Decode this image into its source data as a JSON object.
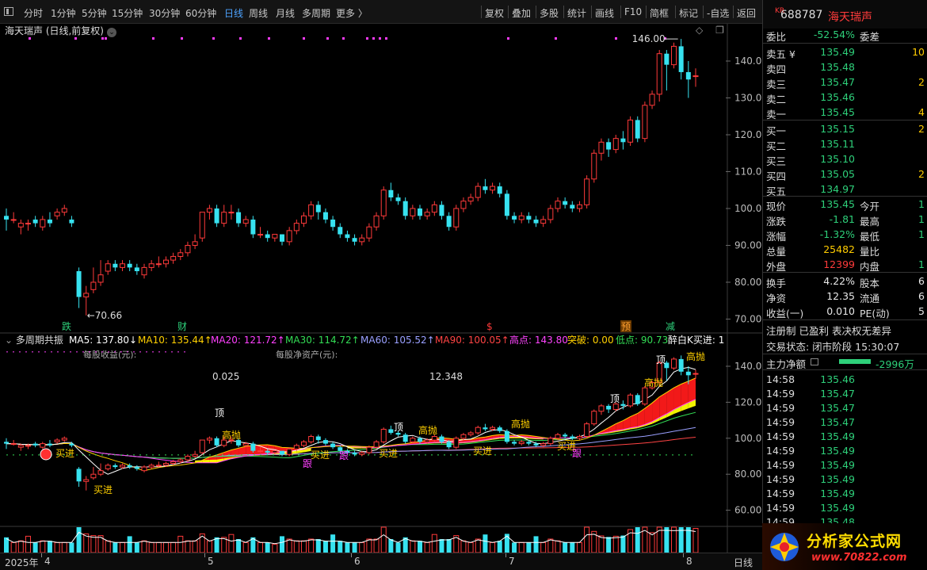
{
  "toolbar": {
    "periods": [
      "分时",
      "1分钟",
      "5分钟",
      "15分钟",
      "30分钟",
      "60分钟",
      "日线",
      "周线",
      "月线",
      "多周期",
      "更多 〉"
    ],
    "active_period": "日线",
    "actions": [
      "复权",
      "叠加",
      "多股",
      "统计",
      "画线",
      "F10",
      "简框",
      "标记",
      "-自选",
      "返回"
    ]
  },
  "chart": {
    "title": "海天瑞声 (日线,前复权)",
    "y_ticks_top": [
      "140.00",
      "130.00",
      "120.00",
      "110.00",
      "100.00",
      "90.00",
      "80.00",
      "70.00"
    ],
    "high_label": "146.00",
    "low_label": "←70.66",
    "event_markers": [
      "跌",
      "财",
      "$",
      "预",
      "减"
    ],
    "indicator_name": "多周期共振",
    "ma": [
      {
        "label": "MA5: 137.80↓",
        "color": "#ffffff"
      },
      {
        "label": "MA10: 135.44↑",
        "color": "#ffd000"
      },
      {
        "label": "MA20: 121.72↑",
        "color": "#ff40ff"
      },
      {
        "label": "MA30: 114.72↑",
        "color": "#33dd55"
      },
      {
        "label": "MA60: 105.52↑",
        "color": "#9aa0ff"
      },
      {
        "label": "MA90: 100.05↑",
        "color": "#ff4444"
      },
      {
        "label": "高点: 143.80",
        "color": "#ff44ff"
      },
      {
        "label": "突破: 0.00",
        "color": "#ffd000"
      },
      {
        "label": "低点: 90.73",
        "color": "#33dd55"
      },
      {
        "label": "醉白K买进: 1",
        "color": "#ffffff"
      }
    ],
    "eps_label": "每股收益(元):",
    "eps_value": "0.025",
    "nav_label": "每股净资产(元):",
    "nav_value": "12.348",
    "y_ticks_bottom": [
      "140.00",
      "120.00",
      "100.00",
      "80.00",
      "60.00"
    ],
    "signal_labels": [
      "买进",
      "买进",
      "买进",
      "买进",
      "买进",
      "买进",
      "高抛",
      "高抛",
      "高抛",
      "高抛",
      "高抛",
      "顶",
      "顶",
      "顶",
      "顶",
      "跟",
      "跟",
      "跟"
    ],
    "x_labels": [
      "2025年",
      "4",
      "5",
      "6",
      "7",
      "8"
    ],
    "bottom_right_label": "日线"
  },
  "quote": {
    "code": "688787",
    "name": "海天瑞声",
    "weibi_label": "委比",
    "weibi": "-52.54%",
    "weicha_label": "委差",
    "asks": [
      {
        "label": "卖五 ¥",
        "price": "135.49",
        "vol": "10"
      },
      {
        "label": "卖四",
        "price": "135.48",
        "vol": ""
      },
      {
        "label": "卖三",
        "price": "135.47",
        "vol": "2"
      },
      {
        "label": "卖二",
        "price": "135.46",
        "vol": ""
      },
      {
        "label": "卖一",
        "price": "135.45",
        "vol": "4"
      }
    ],
    "bids": [
      {
        "label": "买一",
        "price": "135.15",
        "vol": "2"
      },
      {
        "label": "买二",
        "price": "135.11",
        "vol": ""
      },
      {
        "label": "买三",
        "price": "135.10",
        "vol": ""
      },
      {
        "label": "买四",
        "price": "135.05",
        "vol": "2"
      },
      {
        "label": "买五",
        "price": "134.97",
        "vol": ""
      }
    ],
    "stats": [
      {
        "l1": "现价",
        "v1": "135.45",
        "c1": "green",
        "l2": "今开",
        "v2": "1"
      },
      {
        "l1": "涨跌",
        "v1": "-1.81",
        "c1": "green",
        "l2": "最高",
        "v2": "1"
      },
      {
        "l1": "涨幅",
        "v1": "-1.32%",
        "c1": "green",
        "l2": "最低",
        "v2": "1"
      },
      {
        "l1": "总量",
        "v1": "25482",
        "c1": "yellow",
        "l2": "量比",
        "v2": ""
      },
      {
        "l1": "外盘",
        "v1": "12399",
        "c1": "red",
        "l2": "内盘",
        "v2": "1"
      }
    ],
    "stats2": [
      {
        "l1": "换手",
        "v1": "4.22%",
        "l2": "股本",
        "v2": "6"
      },
      {
        "l1": "净资",
        "v1": "12.35",
        "l2": "流通",
        "v2": "6"
      },
      {
        "l1": "收益(一)",
        "v1": "0.010",
        "l2": "PE(动)",
        "v2": "5"
      }
    ],
    "reg_line": "注册制 已盈利 表决权无差异",
    "trade_status": "交易状态: 闭市阶段 15:30:07",
    "main_flow_label": "主力净额",
    "main_flow_value": "-2996万",
    "ticks": [
      {
        "t": "14:58",
        "p": "135.46"
      },
      {
        "t": "14:59",
        "p": "135.47"
      },
      {
        "t": "14:59",
        "p": "135.47"
      },
      {
        "t": "14:59",
        "p": "135.47"
      },
      {
        "t": "14:59",
        "p": "135.49"
      },
      {
        "t": "14:59",
        "p": "135.49"
      },
      {
        "t": "14:59",
        "p": "135.49"
      },
      {
        "t": "14:59",
        "p": "135.49"
      },
      {
        "t": "14:59",
        "p": "135.49"
      },
      {
        "t": "14:59",
        "p": "135.49"
      },
      {
        "t": "14:59",
        "p": "135.48"
      }
    ],
    "watermark": "分析家公式网",
    "watermark_url": "www.70822.com"
  },
  "chart_data": {
    "type": "candlestick",
    "title": "海天瑞声 (日线,前复权)",
    "ylim": [
      68,
      148
    ],
    "candles": [
      [
        98,
        97,
        100,
        94
      ],
      [
        97,
        97,
        99,
        96
      ],
      [
        95,
        96,
        97,
        93
      ],
      [
        96,
        96,
        97,
        94
      ],
      [
        97,
        96,
        98,
        95
      ],
      [
        95,
        97,
        98,
        94
      ],
      [
        97,
        96,
        99,
        95
      ],
      [
        98,
        99,
        100,
        97
      ],
      [
        99,
        100,
        101,
        98
      ],
      [
        97,
        96,
        98,
        95
      ],
      [
        83,
        76,
        84,
        73
      ],
      [
        76,
        77,
        79,
        71
      ],
      [
        78,
        80,
        84,
        77
      ],
      [
        80,
        82,
        86,
        79
      ],
      [
        83,
        85,
        86,
        82
      ],
      [
        85,
        84,
        86,
        83
      ],
      [
        84,
        85,
        86,
        83
      ],
      [
        85,
        84,
        86,
        83
      ],
      [
        84,
        83,
        85,
        82
      ],
      [
        82,
        84,
        85,
        81
      ],
      [
        84,
        85,
        86,
        83
      ],
      [
        85,
        85,
        87,
        84
      ],
      [
        85,
        86,
        87,
        84
      ],
      [
        86,
        87,
        88,
        85
      ],
      [
        87,
        88,
        89,
        86
      ],
      [
        88,
        90,
        91,
        87
      ],
      [
        90,
        91,
        93,
        89
      ],
      [
        92,
        99,
        99,
        91
      ],
      [
        99,
        100,
        101,
        97
      ],
      [
        100,
        96,
        101,
        95
      ],
      [
        96,
        99,
        101,
        95
      ],
      [
        99,
        99,
        101,
        97
      ],
      [
        99,
        96,
        100,
        95
      ],
      [
        96,
        97,
        98,
        95
      ],
      [
        97,
        93,
        98,
        92
      ],
      [
        93,
        93,
        95,
        92
      ],
      [
        93,
        92,
        94,
        91
      ],
      [
        92,
        93,
        93,
        91
      ],
      [
        93,
        91,
        93,
        90
      ],
      [
        91,
        94,
        95,
        90
      ],
      [
        94,
        96,
        97,
        93
      ],
      [
        96,
        98,
        99,
        95
      ],
      [
        98,
        101,
        102,
        97
      ],
      [
        101,
        99,
        102,
        97
      ],
      [
        99,
        97,
        100,
        96
      ],
      [
        97,
        95,
        98,
        94
      ],
      [
        95,
        93,
        96,
        92
      ],
      [
        93,
        92,
        94,
        91
      ],
      [
        92,
        91,
        93,
        90
      ],
      [
        91,
        92,
        93,
        90
      ],
      [
        92,
        95,
        96,
        91
      ],
      [
        95,
        98,
        99,
        94
      ],
      [
        98,
        105,
        106,
        97
      ],
      [
        105,
        103,
        107,
        102
      ],
      [
        103,
        102,
        104,
        101
      ],
      [
        102,
        98,
        103,
        97
      ],
      [
        98,
        100,
        101,
        97
      ],
      [
        100,
        98,
        101,
        97
      ],
      [
        98,
        99,
        100,
        97
      ],
      [
        99,
        101,
        102,
        98
      ],
      [
        101,
        98,
        102,
        97
      ],
      [
        98,
        95,
        99,
        94
      ],
      [
        95,
        100,
        101,
        94
      ],
      [
        100,
        102,
        103,
        99
      ],
      [
        102,
        103,
        104,
        101
      ],
      [
        103,
        106,
        107,
        102
      ],
      [
        106,
        105,
        108,
        104
      ],
      [
        105,
        106,
        107,
        104
      ],
      [
        106,
        104,
        107,
        103
      ],
      [
        104,
        98,
        105,
        97
      ],
      [
        98,
        97,
        99,
        96
      ],
      [
        97,
        98,
        99,
        96
      ],
      [
        98,
        97,
        99,
        96
      ],
      [
        97,
        96,
        98,
        95
      ],
      [
        96,
        97,
        98,
        95
      ],
      [
        97,
        100,
        101,
        96
      ],
      [
        100,
        102,
        103,
        99
      ],
      [
        102,
        101,
        103,
        100
      ],
      [
        101,
        100,
        102,
        99
      ],
      [
        100,
        101,
        102,
        99
      ],
      [
        101,
        108,
        109,
        100
      ],
      [
        108,
        115,
        116,
        107
      ],
      [
        115,
        118,
        119,
        113
      ],
      [
        118,
        116,
        119,
        114
      ],
      [
        116,
        119,
        120,
        115
      ],
      [
        119,
        118,
        121,
        116
      ],
      [
        118,
        124,
        125,
        117
      ],
      [
        124,
        119,
        125,
        118
      ],
      [
        119,
        128,
        129,
        118
      ],
      [
        128,
        131,
        132,
        127
      ],
      [
        131,
        142,
        143,
        129
      ],
      [
        142,
        139,
        143,
        132
      ],
      [
        139,
        144,
        145,
        138
      ],
      [
        144,
        137,
        146,
        135
      ],
      [
        137,
        135,
        140,
        130
      ],
      [
        136,
        136,
        138,
        133
      ]
    ]
  }
}
